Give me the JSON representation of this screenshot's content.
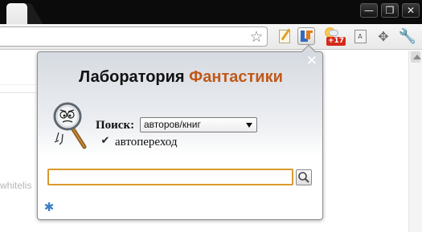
{
  "window": {
    "minimize_glyph": "—",
    "restore_glyph": "❐",
    "close_glyph": "✕"
  },
  "toolbar": {
    "bookmark_glyph": "☆",
    "extensions": [
      {
        "name": "notepad-extension",
        "icon": "notepad-pencil-icon"
      },
      {
        "name": "fantlab-extension",
        "icon": "fantlab-logo-icon"
      },
      {
        "name": "weather-extension",
        "icon": "weather-sun-cloud-icon",
        "badge": "+17"
      },
      {
        "name": "translate-extension",
        "icon": "translate-document-icon",
        "glyph": "A"
      },
      {
        "name": "move-extension",
        "icon": "move-arrows-icon",
        "glyph": "✥"
      },
      {
        "name": "settings-menu",
        "icon": "wrench-icon",
        "glyph": "🔧"
      }
    ]
  },
  "page": {
    "background_text": "whitelis"
  },
  "popup": {
    "title_part1": "Лаборатория",
    "title_part2": "Фантастики",
    "accent_color": "#c0591a",
    "close_glyph": "✕",
    "search_label": "Поиск:",
    "search_scope": "авторов/книг",
    "autojump_checked": true,
    "autojump_glyph": "✔",
    "autojump_label": "автопереход",
    "query_value": "",
    "query_placeholder": "",
    "input_border_color": "#d99a2c",
    "settings_glyph": "✱"
  }
}
